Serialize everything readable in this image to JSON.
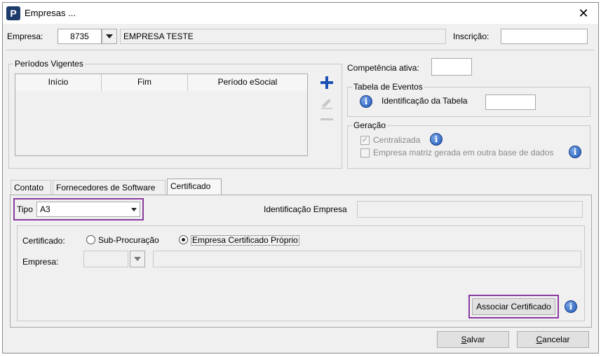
{
  "window": {
    "title": "Empresas ..."
  },
  "header": {
    "empresa_label": "Empresa:",
    "empresa_code": "8735",
    "empresa_name": "EMPRESA TESTE",
    "inscricao_label": "Inscrição:",
    "inscricao_value": ""
  },
  "periodos": {
    "legend": "Períodos Vigentes",
    "columns": [
      "Início",
      "Fim",
      "Período eSocial"
    ]
  },
  "competencia": {
    "label": "Competência ativa:",
    "value": ""
  },
  "tabela_eventos": {
    "legend": "Tabela de Eventos",
    "identificacao_label": "Identificação da Tabela",
    "identificacao_value": ""
  },
  "geracao": {
    "legend": "Geração",
    "centralizada_label": "Centralizada",
    "centralizada_checked": true,
    "matriz_label": "Empresa matriz gerada em outra base de dados",
    "matriz_checked": false
  },
  "tabs": [
    "Contato",
    "Fornecedores de Software",
    "Certificado"
  ],
  "certificado_tab": {
    "tipo_label": "Tipo",
    "tipo_value": "A3",
    "identificacao_empresa_label": "Identificação Empresa",
    "identificacao_empresa_value": "",
    "certificado_label": "Certificado:",
    "radio_sub_label": "Sub-Procuração",
    "radio_proprio_label": "Empresa Certificado Próprio",
    "selected_radio": "proprio",
    "empresa_label": "Empresa:",
    "empresa_code": "",
    "empresa_name": "",
    "associar_button": "Associar Certificado"
  },
  "footer": {
    "salvar_prefix": "S",
    "salvar_rest": "alvar",
    "cancelar_prefix": "C",
    "cancelar_rest": "ancelar"
  },
  "colors": {
    "highlight": "#8b3aa0",
    "accent": "#1c56b5",
    "plus": "#1b4fb0"
  }
}
